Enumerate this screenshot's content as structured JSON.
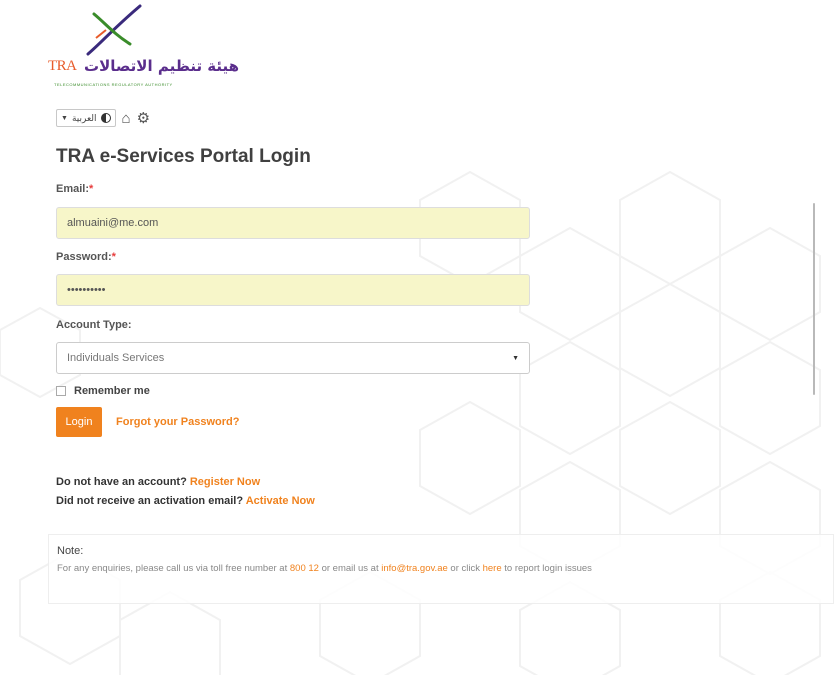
{
  "logo": {
    "abbr": "TRA",
    "arabic_name": "هيئة تنظيم الاتصالات",
    "english_name": "TELECOMMUNICATIONS REGULATORY AUTHORITY"
  },
  "toolbar": {
    "language_value": "العربية",
    "icons": [
      "contrast-icon",
      "home-icon",
      "settings-gear-icon"
    ]
  },
  "page_title": "TRA e-Services Portal Login",
  "form": {
    "email_label": "Email:",
    "email_value": "almuaini@me.com",
    "password_label": "Password:",
    "password_value": "••••••••••",
    "required_mark": "*",
    "account_type_label": "Account Type:",
    "account_type_value": "Individuals Services",
    "remember_label": "Remember me",
    "login_button": "Login",
    "forgot_link": "Forgot your Password?"
  },
  "account": {
    "no_account_text": "Do not have an account?",
    "register_link": "Register Now",
    "no_activation_text": "Did not receive an activation email?",
    "activate_link": "Activate Now"
  },
  "note": {
    "title": "Note:",
    "text_part1": "For any enquiries, please call us via toll free number at",
    "phone": "800 12",
    "text_part2": "or email us at",
    "email": "info@tra.gov.ae",
    "text_part3": "or click",
    "here_link": "here",
    "text_part4": "to report login issues"
  },
  "colors": {
    "accent_orange": "#f0821e",
    "autofill_yellow": "#f7f6c9",
    "required_red": "#e73c3c",
    "logo_purple": "#5a2d8c",
    "logo_green": "#3a8c2a"
  }
}
